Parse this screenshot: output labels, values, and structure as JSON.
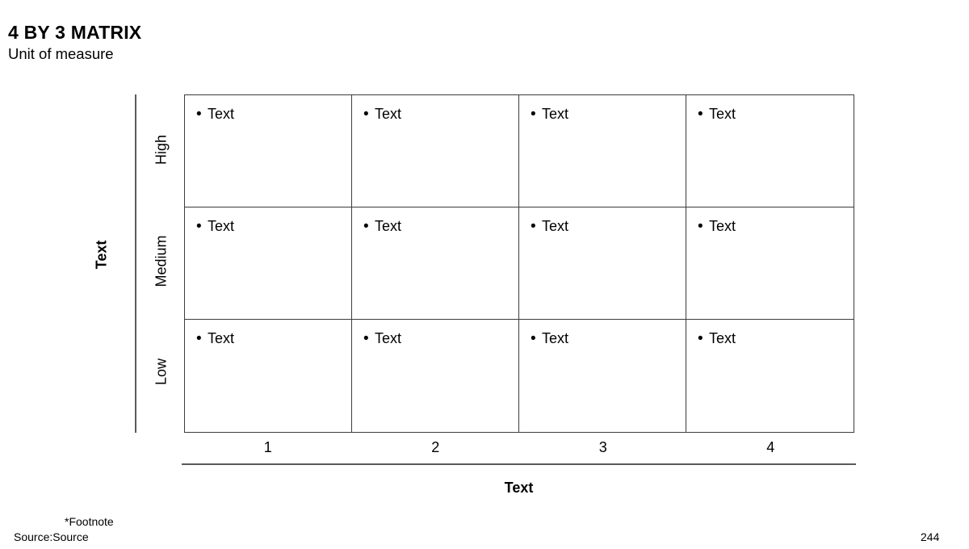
{
  "header": {
    "title": "4 BY 3 MATRIX",
    "subtitle": "Unit of measure"
  },
  "axes": {
    "y_title": "Text",
    "x_title": "Text"
  },
  "matrix": {
    "row_labels": [
      "High",
      "Medium",
      "Low"
    ],
    "column_labels": [
      "1",
      "2",
      "3",
      "4"
    ],
    "cells": [
      [
        {
          "bullet": "•",
          "text": "Text"
        },
        {
          "bullet": "•",
          "text": "Text"
        },
        {
          "bullet": "•",
          "text": "Text"
        },
        {
          "bullet": "•",
          "text": "Text"
        }
      ],
      [
        {
          "bullet": "•",
          "text": "Text"
        },
        {
          "bullet": "•",
          "text": "Text"
        },
        {
          "bullet": "•",
          "text": "Text"
        },
        {
          "bullet": "•",
          "text": "Text"
        }
      ],
      [
        {
          "bullet": "•",
          "text": "Text"
        },
        {
          "bullet": "•",
          "text": "Text"
        },
        {
          "bullet": "•",
          "text": "Text"
        },
        {
          "bullet": "•",
          "text": "Text"
        }
      ]
    ]
  },
  "footer": {
    "footnote": "*Footnote",
    "source": "Source:Source",
    "page_number": "244"
  },
  "colors": {
    "text": "#000000",
    "grid_line": "#3c3c3c",
    "axis_line": "#5a5a5a",
    "background": "#ffffff"
  },
  "chart_data": {
    "type": "table",
    "title": "4 BY 3 MATRIX",
    "subtitle": "Unit of measure",
    "xlabel": "Text",
    "ylabel": "Text",
    "categories": [
      "1",
      "2",
      "3",
      "4"
    ],
    "rows": [
      "High",
      "Medium",
      "Low"
    ],
    "grid": [
      [
        "Text",
        "Text",
        "Text",
        "Text"
      ],
      [
        "Text",
        "Text",
        "Text",
        "Text"
      ],
      [
        "Text",
        "Text",
        "Text",
        "Text"
      ]
    ],
    "grid_lines": true,
    "legend": "none"
  }
}
